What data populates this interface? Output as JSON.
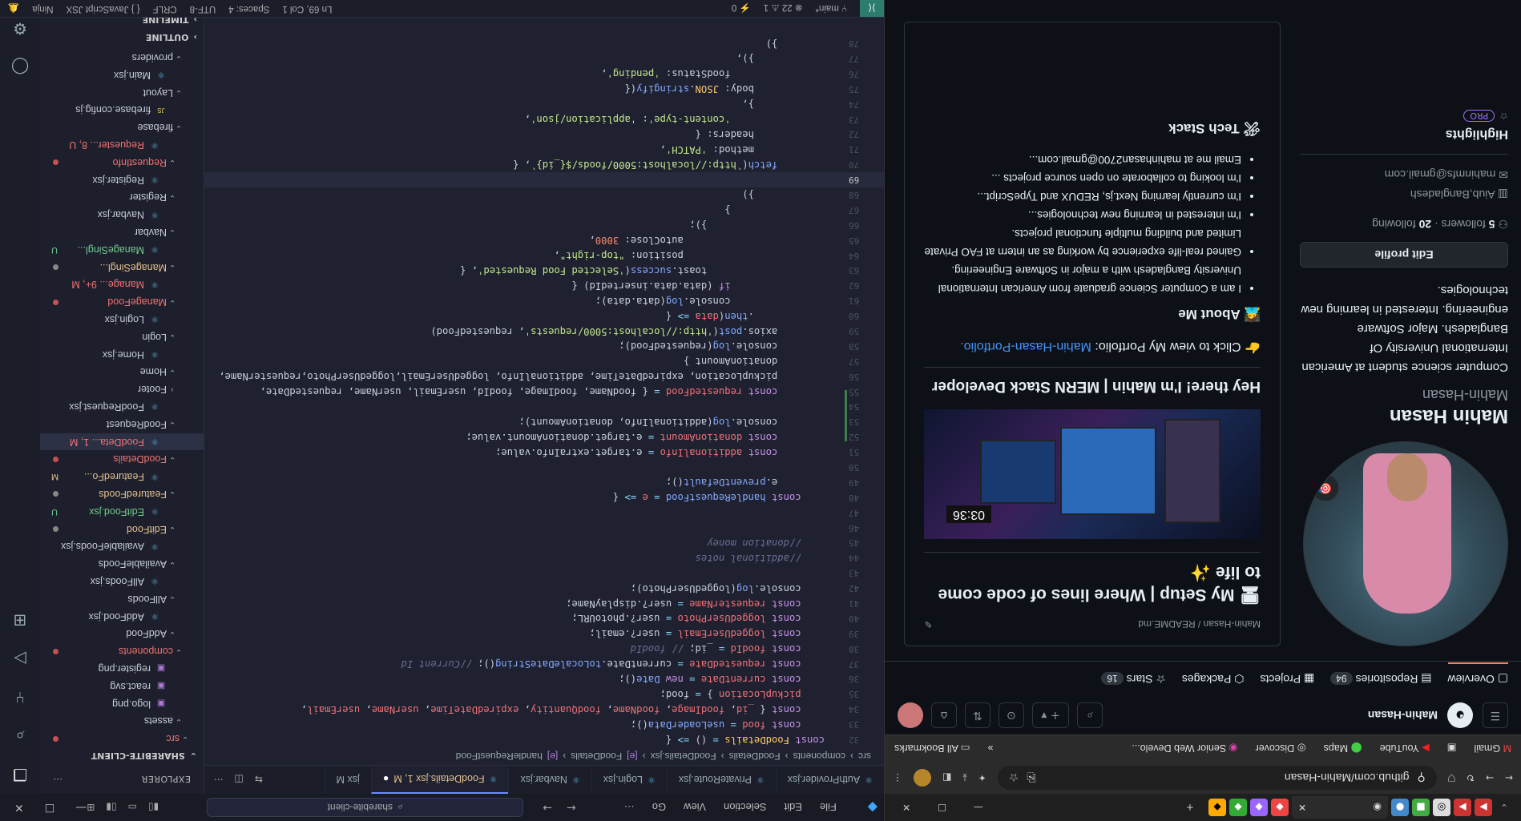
{
  "vscode": {
    "menu": [
      "File",
      "Edit",
      "Selection",
      "View",
      "Go"
    ],
    "search": "sharebite-client",
    "tabs": [
      {
        "label": "AuthProvider.jsx",
        "active": false
      },
      {
        "label": "PrivateRoute.jsx",
        "active": false
      },
      {
        "label": "Login.jsx",
        "active": false
      },
      {
        "label": "Navbar.jsx",
        "active": false
      },
      {
        "label": "FoodDetails.jsx 1, M",
        "active": true
      },
      {
        "label": "jsx M",
        "active": false
      }
    ],
    "breadcrumb": [
      "src",
      "components",
      "FoodDetails",
      "FoodDetails.jsx",
      "FoodDetails",
      "handleRequestFood"
    ],
    "sidebar": {
      "title": "EXPLORER",
      "project": "SHAREBITE-CLIENT",
      "timeline": "TIMELINE",
      "outline": "OUTLINE",
      "items": [
        {
          "label": "src",
          "kind": "folder",
          "depth": 1,
          "status": "dot-red",
          "cls": "err"
        },
        {
          "label": "assets",
          "kind": "folder",
          "depth": 2,
          "status": "",
          "cls": ""
        },
        {
          "label": "logo.png",
          "kind": "img",
          "depth": 3,
          "status": "",
          "cls": ""
        },
        {
          "label": "react.svg",
          "kind": "img",
          "depth": 3,
          "status": "",
          "cls": ""
        },
        {
          "label": "register.png",
          "kind": "img",
          "depth": 3,
          "status": "",
          "cls": ""
        },
        {
          "label": "components",
          "kind": "folder",
          "depth": 2,
          "status": "dot-red",
          "cls": "err"
        },
        {
          "label": "AddFood",
          "kind": "folder",
          "depth": 3,
          "status": "",
          "cls": ""
        },
        {
          "label": "AddFood.jsx",
          "kind": "jsx",
          "depth": 4,
          "status": "",
          "cls": ""
        },
        {
          "label": "AllFoods",
          "kind": "folder",
          "depth": 3,
          "status": "",
          "cls": ""
        },
        {
          "label": "AllFoods.jsx",
          "kind": "jsx",
          "depth": 4,
          "status": "",
          "cls": ""
        },
        {
          "label": "AvailableFoods",
          "kind": "folder",
          "depth": 3,
          "status": "",
          "cls": ""
        },
        {
          "label": "AvailableFoods.jsx",
          "kind": "jsx",
          "depth": 4,
          "status": "",
          "cls": ""
        },
        {
          "label": "EditFood",
          "kind": "folder",
          "depth": 3,
          "status": "dot",
          "cls": "mod"
        },
        {
          "label": "EditFood.jsx",
          "kind": "jsx",
          "depth": 4,
          "status": "U",
          "cls": "untracked"
        },
        {
          "label": "FeaturedFoods",
          "kind": "folder",
          "depth": 3,
          "status": "dot",
          "cls": "mod"
        },
        {
          "label": "FeaturedFo...",
          "kind": "jsx",
          "depth": 4,
          "status": "M",
          "cls": "mod"
        },
        {
          "label": "FoodDetails",
          "kind": "folder",
          "depth": 3,
          "status": "dot-red",
          "cls": "err"
        },
        {
          "label": "FoodDeta... 1, M",
          "kind": "jsx",
          "depth": 4,
          "status": "",
          "cls": "err sel"
        },
        {
          "label": "FoodRequest",
          "kind": "folder",
          "depth": 3,
          "status": "",
          "cls": ""
        },
        {
          "label": "FoodRequest.jsx",
          "kind": "jsx",
          "depth": 4,
          "status": "",
          "cls": ""
        },
        {
          "label": "Footer",
          "kind": "folder-closed",
          "depth": 3,
          "status": "",
          "cls": ""
        },
        {
          "label": "Home",
          "kind": "folder",
          "depth": 3,
          "status": "",
          "cls": ""
        },
        {
          "label": "Home.jsx",
          "kind": "jsx",
          "depth": 4,
          "status": "",
          "cls": ""
        },
        {
          "label": "Login",
          "kind": "folder",
          "depth": 3,
          "status": "",
          "cls": ""
        },
        {
          "label": "Login.jsx",
          "kind": "jsx",
          "depth": 4,
          "status": "",
          "cls": ""
        },
        {
          "label": "ManageFood",
          "kind": "folder",
          "depth": 3,
          "status": "dot-red",
          "cls": "err"
        },
        {
          "label": "Manage... 9+, M",
          "kind": "jsx",
          "depth": 4,
          "status": "",
          "cls": "err"
        },
        {
          "label": "ManageSingl...",
          "kind": "folder",
          "depth": 3,
          "status": "dot",
          "cls": "mod"
        },
        {
          "label": "ManageSingl...",
          "kind": "jsx",
          "depth": 4,
          "status": "U",
          "cls": "untracked"
        },
        {
          "label": "Navbar",
          "kind": "folder",
          "depth": 3,
          "status": "",
          "cls": ""
        },
        {
          "label": "Navbar.jsx",
          "kind": "jsx",
          "depth": 4,
          "status": "",
          "cls": ""
        },
        {
          "label": "Register",
          "kind": "folder",
          "depth": 3,
          "status": "",
          "cls": ""
        },
        {
          "label": "Register.jsx",
          "kind": "jsx",
          "depth": 4,
          "status": "",
          "cls": ""
        },
        {
          "label": "RequestInfo",
          "kind": "folder",
          "depth": 3,
          "status": "dot-red",
          "cls": "err"
        },
        {
          "label": "Requester... 8, U",
          "kind": "jsx",
          "depth": 4,
          "status": "",
          "cls": "err"
        },
        {
          "label": "firebase",
          "kind": "folder",
          "depth": 2,
          "status": "",
          "cls": ""
        },
        {
          "label": "firebase.config.js",
          "kind": "js",
          "depth": 3,
          "status": "",
          "cls": ""
        },
        {
          "label": "Layout",
          "kind": "folder",
          "depth": 2,
          "status": "",
          "cls": ""
        },
        {
          "label": "Main.jsx",
          "kind": "jsx",
          "depth": 3,
          "status": "",
          "cls": ""
        },
        {
          "label": "providers",
          "kind": "folder",
          "depth": 2,
          "status": "",
          "cls": ""
        }
      ]
    },
    "code_lines": [
      {
        "n": 32,
        "h": "<span class='k'>const</span> <span class='y'>FoodDetails</span> <span class='p'>=</span> () <span class='p'>=&gt;</span> {"
      },
      {
        "n": 33,
        "h": "    <span class='k'>const</span> <span class='v'>food</span> <span class='p'>=</span> <span class='f'>useLoaderData</span>();"
      },
      {
        "n": 34,
        "h": "    <span class='k'>const</span> { <span class='v'>_id</span>, <span class='v'>foodImage</span>, <span class='v'>foodName</span>, <span class='v'>foodQuantity</span>, <span class='v'>expiredDateTime</span>, <span class='v'>userName</span>, <span class='v'>userEmail</span>,"
      },
      {
        "n": 35,
        "h": "    <span class='v'>pickupLocation</span> } <span class='p'>=</span> food;"
      },
      {
        "n": 36,
        "h": "    <span class='k'>const</span> <span class='v'>currentDate</span> <span class='p'>=</span> <span class='k'>new</span> <span class='f'>Date</span>();"
      },
      {
        "n": 37,
        "h": "    <span class='k'>const</span> <span class='v'>requestedDate</span> <span class='p'>=</span> currentDate.<span class='f'>toLocaleDateString</span>(); <span class='c'>//Current Id</span>"
      },
      {
        "n": 38,
        "h": "    <span class='k'>const</span> <span class='v'>foodId</span> <span class='p'>=</span> _id; <span class='c'>// foodId</span>"
      },
      {
        "n": 39,
        "h": "    <span class='k'>const</span> <span class='v'>loggedUserEmail</span> <span class='p'>=</span> user?.email;"
      },
      {
        "n": 40,
        "h": "    <span class='k'>const</span> <span class='v'>loggedUserPhoto</span> <span class='p'>=</span> user?.photoURL;"
      },
      {
        "n": 41,
        "h": "    <span class='k'>const</span> <span class='v'>requesterName</span> <span class='p'>=</span> user?.displayName;"
      },
      {
        "n": 42,
        "h": "    console.<span class='f'>log</span>(loggedUserPhoto);"
      },
      {
        "n": 43,
        "h": ""
      },
      {
        "n": 44,
        "h": "    <span class='c'>//additional notes</span>"
      },
      {
        "n": 45,
        "h": "    <span class='c'>//donation money</span>"
      },
      {
        "n": 46,
        "h": ""
      },
      {
        "n": 47,
        "h": ""
      },
      {
        "n": 48,
        "h": "    <span class='k'>const</span> <span class='f'>handleRequestFood</span> <span class='p'>=</span> <span class='v'>e</span> <span class='p'>=&gt;</span> {"
      },
      {
        "n": 49,
        "h": "        e.<span class='f'>preventDefault</span>();"
      },
      {
        "n": 50,
        "h": ""
      },
      {
        "n": 51,
        "h": "        <span class='k'>const</span> <span class='v'>additionalInfo</span> <span class='p'>=</span> e.target.extraInfo.value;"
      },
      {
        "n": 52,
        "h": "        <span class='k'>const</span> <span class='v'>donationAmount</span> <span class='p'>=</span> e.target.donationAmount.value;"
      },
      {
        "n": 53,
        "h": "        console.<span class='f'>log</span>(additionalInfo, donationAmount);"
      },
      {
        "n": 54,
        "h": ""
      },
      {
        "n": 55,
        "h": "        <span class='k'>const</span> <span class='v'>requestedFood</span> <span class='p'>=</span> { foodName, foodImage, foodId, userEmail, userName, requestedDate,"
      },
      {
        "n": 56,
        "h": "        pickupLocation, expiredDateTime, additionalInfo, loggedUserEmail,loggedUserPhoto,requesterName,"
      },
      {
        "n": 57,
        "h": "        donationAmount }"
      },
      {
        "n": 58,
        "h": "        console.<span class='f'>log</span>(requestedFood);"
      },
      {
        "n": 59,
        "h": "        axios.<span class='f'>post</span>(<span class='s'>'http://localhost:5000/requests'</span>, requestedFood)"
      },
      {
        "n": 60,
        "h": "            .<span class='f'>then</span>(<span class='v'>data</span> <span class='p'>=&gt;</span> {"
      },
      {
        "n": 61,
        "h": "                console.<span class='f'>log</span>(data.data);"
      },
      {
        "n": 62,
        "h": "                <span class='k'>if</span> (data.data.insertedId) {"
      },
      {
        "n": 63,
        "h": "                    toast.<span class='f'>success</span>(<span class='s'>'Selected Food Requested'</span>, {"
      },
      {
        "n": 64,
        "h": "                        position: <span class='s'>\"top-right\"</span>,"
      },
      {
        "n": 65,
        "h": "                        autoClose: <span class='n'>3000</span>,"
      },
      {
        "n": 66,
        "h": "                    });"
      },
      {
        "n": 67,
        "h": "                }"
      },
      {
        "n": 68,
        "h": "            })"
      },
      {
        "n": 69,
        "h": ""
      },
      {
        "n": 70,
        "h": "        <span class='f'>fetch</span>(<span class='s'>`http://localhost:5000/foods/${_id}`</span>, {"
      },
      {
        "n": 71,
        "h": "            method: <span class='s'>'PATCH'</span>,"
      },
      {
        "n": 72,
        "h": "            headers: {"
      },
      {
        "n": 73,
        "h": "                <span class='s'>'content-type'</span>: <span class='s'>'application/json'</span>,"
      },
      {
        "n": 74,
        "h": "            },"
      },
      {
        "n": 75,
        "h": "            body: <span class='y'>JSON</span>.<span class='f'>stringify</span>({"
      },
      {
        "n": 76,
        "h": "                foodStatus: <span class='s'>'pending'</span>,"
      },
      {
        "n": 77,
        "h": "            }),"
      },
      {
        "n": 78,
        "h": "        })"
      }
    ],
    "current_line": 69,
    "status": {
      "branch": "main*",
      "problems": "22",
      "warnings": "1",
      "ports": "0",
      "position": "Ln 69, Col 1",
      "spaces": "Spaces: 4",
      "encoding": "UTF-8",
      "eol": "CRLF",
      "language": "{ }  JavaScript JSX",
      "ninja": "Ninja"
    }
  },
  "browser": {
    "url": "github.com/Mahin-Hasan",
    "bookmarks": [
      "Gmail",
      "YouTube",
      "Maps",
      "Discover",
      "Senior Web Develo...",
      "All Bookmarks"
    ],
    "user": "Mahin-Hasan",
    "nav": [
      {
        "label": "Overview",
        "count": ""
      },
      {
        "label": "Repositories",
        "count": "94"
      },
      {
        "label": "Projects",
        "count": ""
      },
      {
        "label": "Packages",
        "count": ""
      },
      {
        "label": "Stars",
        "count": "16"
      }
    ],
    "profile": {
      "name": "Mahin Hasan",
      "username": "Mahin-Hasan",
      "bio": "Computer science student at American International University Of Bangladesh. Major Software engineering. Interested in learning new technologies.",
      "edit": "Edit profile",
      "followers": "5",
      "followers_label": "followers",
      "following": "20",
      "following_label": "following",
      "location": "Aiub,Bangladesh",
      "email": "mahinmfs@gmail.com",
      "highlights": "Highlights",
      "pro": "PRO"
    },
    "readme": {
      "path": "Mahin-Hasan / README.md",
      "setup_heading": "My Setup | Where lines of code come to life ✨",
      "clock": "03:36",
      "intro": "Hey there! I'm Mahin | MERN Stack Developer",
      "portfolio_prefix": "Click to view My Portfolio: ",
      "portfolio_link": "Mahin-Hasan-Portfolio.",
      "about": "About Me",
      "about_items": [
        "I am a Computer Science graduate from American International University Bangladesh with a major in Software Engineering.",
        "Gained real-life experience by working as an intern at FAO Private Limited and building multiple functional projects.",
        "I'm interested in learning new technologies...",
        "I'm currently learning Next.js, REDUX and TypeScript...",
        "I'm looking to collaborate on open source projects ...",
        "Email me at mahinhasan2700@gmail.com..."
      ],
      "tech": "Tech Stack"
    }
  }
}
